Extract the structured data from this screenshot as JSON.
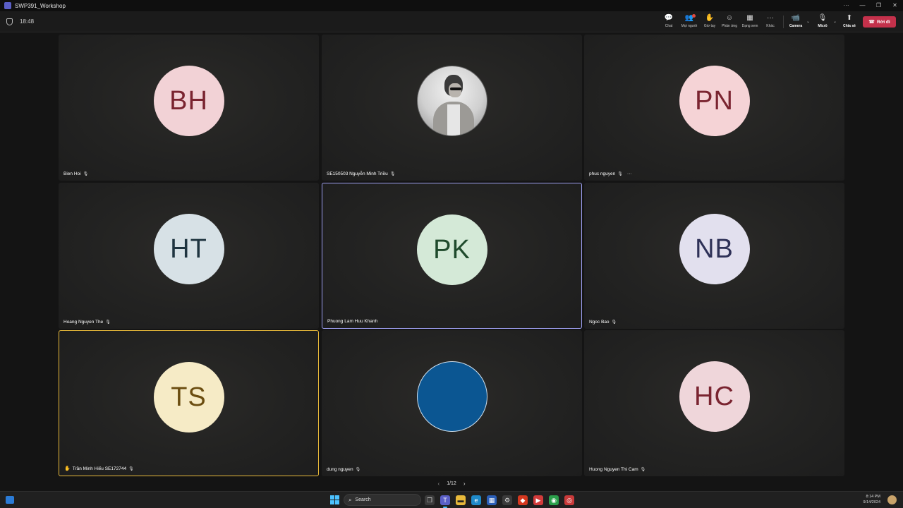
{
  "window": {
    "title": "SWP391_Workshop"
  },
  "meeting": {
    "elapsed": "18:48"
  },
  "toolbar": {
    "chat": "Chat",
    "people": "Mọi người",
    "raise": "Giơ tay",
    "react": "Phản ứng",
    "view": "Dạng xem",
    "more": "Khác",
    "camera": "Camera",
    "mic": "Micrô",
    "share": "Chia sẻ",
    "leave": "Rời đi"
  },
  "tiles": [
    {
      "initials": "BH",
      "name": "Bien Hoi",
      "bg": "#f2d2d6",
      "fg": "#7a2430"
    },
    {
      "initials": "",
      "name": "SE150503 Nguyễn Minh Triều",
      "bg": "",
      "fg": ""
    },
    {
      "initials": "PN",
      "name": "phuc nguyen",
      "bg": "#f5d3d6",
      "fg": "#7a2430"
    },
    {
      "initials": "HT",
      "name": "Hoang Nguyen The",
      "bg": "#d7e1e6",
      "fg": "#1f3440"
    },
    {
      "initials": "PK",
      "name": "Phuong Lam Huu Khanh",
      "bg": "#d4e9d7",
      "fg": "#1f4a2c"
    },
    {
      "initials": "NB",
      "name": "Ngoc Bao",
      "bg": "#e2e0ee",
      "fg": "#2e3157"
    },
    {
      "initials": "TS",
      "name": "Trần Minh Hiếu SE172744",
      "bg": "#f6ebc6",
      "fg": "#6b4d10"
    },
    {
      "initials": "",
      "name": "dung nguyen",
      "bg": "#0b5692",
      "fg": ""
    },
    {
      "initials": "HC",
      "name": "Huong Nguyen Thi Cam",
      "bg": "#efd6da",
      "fg": "#7a2430"
    }
  ],
  "pager": {
    "label": "1/12"
  },
  "taskbar": {
    "search": "Search",
    "time": "8:14 PM",
    "date": "9/14/2024"
  },
  "icons": {
    "chat": "chat-icon",
    "people": "people-icon",
    "raise": "hand-icon",
    "react": "smile-icon",
    "view": "grid-icon",
    "more": "ellipsis-icon",
    "camera": "camera-icon",
    "mic": "mic-off-icon",
    "share": "share-icon",
    "leave": "phone-icon"
  }
}
